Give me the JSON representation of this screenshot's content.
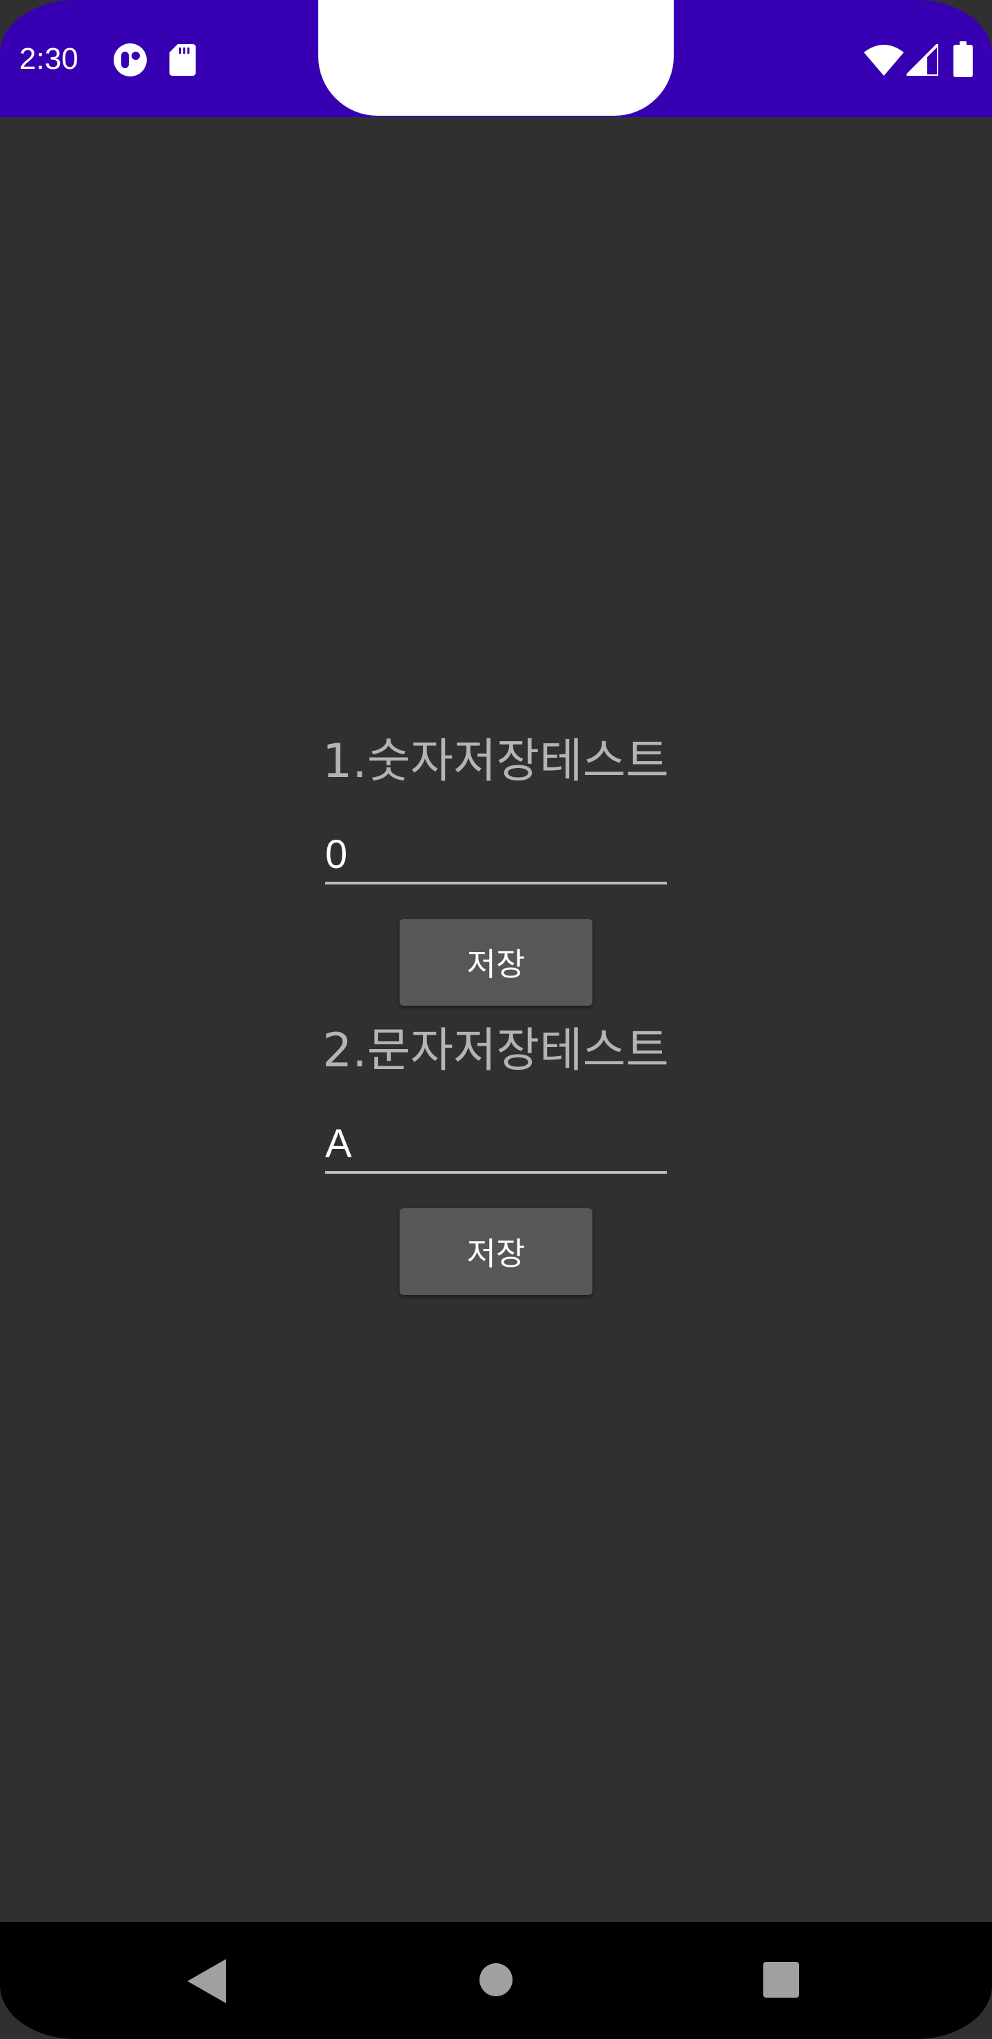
{
  "status_bar": {
    "time": "2:30",
    "icons": [
      "notification-icon",
      "sd-card-icon",
      "wifi-icon",
      "cell-signal-icon",
      "battery-icon"
    ],
    "color": "#3700b3"
  },
  "sections": [
    {
      "title": "1.숫자저장테스트",
      "field_value": "0",
      "button_label": "저장"
    },
    {
      "title": "2.문자저장테스트",
      "field_value": "A",
      "button_label": "저장"
    }
  ],
  "nav_bar": {
    "icons": [
      "back-icon",
      "home-icon",
      "recents-icon"
    ]
  },
  "colors": {
    "background": "#303030",
    "button": "#575757",
    "title_text": "#b4b4b4"
  }
}
